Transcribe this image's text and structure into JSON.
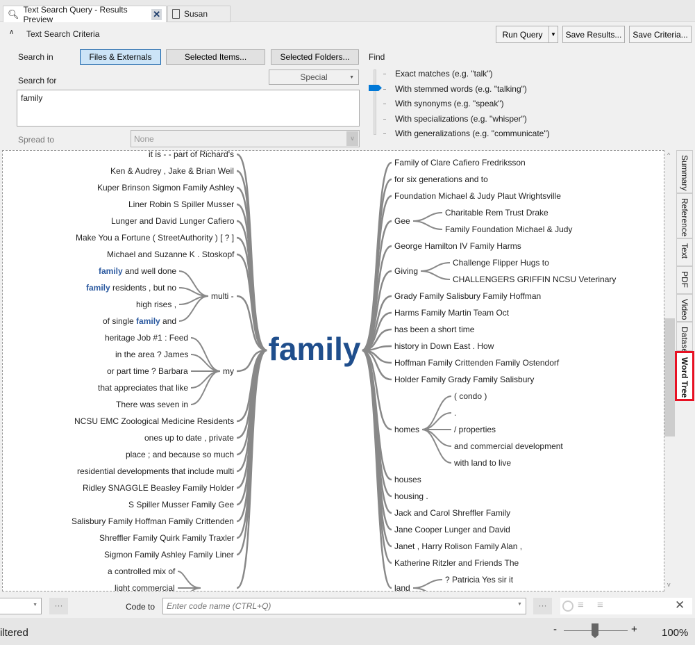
{
  "tabs": [
    {
      "label": "Text Search Query - Results Preview",
      "icon": "text-search-icon",
      "active": true
    },
    {
      "label": "Susan",
      "icon": "document-icon",
      "active": false
    }
  ],
  "criteria": {
    "title": "Text Search Criteria",
    "search_in_label": "Search in",
    "scope_buttons": [
      "Files & Externals",
      "Selected Items...",
      "Selected Folders..."
    ],
    "search_for_label": "Search for",
    "special_label": "Special",
    "search_value": "family",
    "spread_label": "Spread to",
    "spread_value": "None",
    "run_query": "Run Query",
    "save_results": "Save Results...",
    "save_criteria": "Save Criteria...",
    "find_label": "Find",
    "find_options": [
      "Exact matches (e.g. \"talk\")",
      "With stemmed words (e.g. \"talking\")",
      "With synonyms (e.g. \"speak\")",
      "With specializations (e.g. \"whisper\")",
      "With generalizations (e.g. \"communicate\")"
    ],
    "find_selected_index": 1,
    "accent": "#0078d7"
  },
  "word_tree": {
    "root": "family",
    "root_color": "#1f4e8c",
    "left": [
      {
        "text": [
          {
            "t": "it is - - part of Richard's"
          }
        ]
      },
      {
        "text": [
          {
            "t": "Ken & Audrey , Jake & Brian Weil"
          }
        ]
      },
      {
        "text": [
          {
            "t": "Kuper Brinson Sigmon Family Ashley"
          }
        ]
      },
      {
        "text": [
          {
            "t": "Liner Robin S Spiller Musser"
          }
        ]
      },
      {
        "text": [
          {
            "t": "Lunger and David Lunger Cafiero"
          }
        ]
      },
      {
        "text": [
          {
            "t": "Make You a Fortune ( StreetAuthority ) [ ? ]"
          }
        ]
      },
      {
        "text": [
          {
            "t": "Michael and Suzanne K . Stoskopf"
          }
        ]
      },
      {
        "label": "multi -",
        "children": [
          [
            {
              "t": "family",
              "hl": true
            },
            {
              "t": " and well done"
            }
          ],
          [
            {
              "t": "family",
              "hl": true
            },
            {
              "t": " residents , but no"
            }
          ],
          [
            {
              "t": "high rises ,"
            }
          ],
          [
            {
              "t": "of single "
            },
            {
              "t": "family",
              "hl": true
            },
            {
              "t": " and"
            }
          ]
        ]
      },
      {
        "label": "my",
        "children": [
          [
            {
              "t": "heritage Job #1 : Feed"
            }
          ],
          [
            {
              "t": "in the area ? James"
            }
          ],
          [
            {
              "t": "or part time ? Barbara"
            }
          ],
          [
            {
              "t": "that appreciates that like"
            }
          ],
          [
            {
              "t": "There was seven in"
            }
          ]
        ]
      },
      {
        "text": [
          {
            "t": "NCSU EMC Zoological Medicine Residents"
          }
        ]
      },
      {
        "text": [
          {
            "t": "ones up to date , private"
          }
        ]
      },
      {
        "text": [
          {
            "t": "place ; and because so much"
          }
        ]
      },
      {
        "text": [
          {
            "t": "residential developments that include multi"
          }
        ]
      },
      {
        "text": [
          {
            "t": "Ridley SNAGGLE Beasley Family Holder"
          }
        ]
      },
      {
        "text": [
          {
            "t": "S Spiller Musser Family Gee"
          }
        ]
      },
      {
        "text": [
          {
            "t": "Salisbury Family Hoffman Family Crittenden"
          }
        ]
      },
      {
        "text": [
          {
            "t": "Shreffler Family Quirk Family Traxler"
          }
        ]
      },
      {
        "text": [
          {
            "t": "Sigmon Family Ashley Family Liner"
          }
        ]
      },
      {
        "label": "",
        "children": [
          [
            {
              "t": "a controlled mix of"
            }
          ],
          [
            {
              "t": "light commercial"
            }
          ],
          [
            {
              "t": ""
            }
          ]
        ]
      }
    ],
    "right": [
      {
        "text": [
          {
            "t": "Family of Clare Cafiero Fredriksson"
          }
        ]
      },
      {
        "text": [
          {
            "t": "for six generations and to"
          }
        ]
      },
      {
        "text": [
          {
            "t": "Foundation Michael & Judy Plaut Wrightsville"
          }
        ]
      },
      {
        "label": "Gee",
        "children": [
          [
            {
              "t": "Charitable Rem Trust Drake"
            }
          ],
          [
            {
              "t": "Family Foundation Michael & Judy"
            }
          ]
        ]
      },
      {
        "text": [
          {
            "t": "George Hamilton IV Family Harms"
          }
        ]
      },
      {
        "label": "Giving",
        "children": [
          [
            {
              "t": "Challenge Flipper Hugs to"
            }
          ],
          [
            {
              "t": "CHALLENGERS GRIFFIN NCSU Veterinary"
            }
          ]
        ]
      },
      {
        "text": [
          {
            "t": "Grady Family Salisbury Family Hoffman"
          }
        ]
      },
      {
        "text": [
          {
            "t": "Harms Family Martin Team Oct"
          }
        ]
      },
      {
        "text": [
          {
            "t": "has been a short time"
          }
        ]
      },
      {
        "text": [
          {
            "t": "history in Down East . How"
          }
        ]
      },
      {
        "text": [
          {
            "t": "Hoffman Family Crittenden Family Ostendorf"
          }
        ]
      },
      {
        "text": [
          {
            "t": "Holder Family Grady Family Salisbury"
          }
        ]
      },
      {
        "label": "homes",
        "children": [
          [
            {
              "t": "( condo )"
            }
          ],
          [
            {
              "t": "."
            }
          ],
          [
            {
              "t": "/ properties"
            }
          ],
          [
            {
              "t": "and commercial development"
            }
          ],
          [
            {
              "t": "with land to live"
            }
          ]
        ]
      },
      {
        "text": [
          {
            "t": "houses"
          }
        ]
      },
      {
        "text": [
          {
            "t": "housing ."
          }
        ]
      },
      {
        "text": [
          {
            "t": "Jack and Carol Shreffler Family"
          }
        ]
      },
      {
        "text": [
          {
            "t": "Jane Cooper Lunger and David"
          }
        ]
      },
      {
        "text": [
          {
            "t": "Janet , Harry Rolison Family Alan ,"
          }
        ]
      },
      {
        "text": [
          {
            "t": "Katherine Ritzler and Friends The"
          }
        ]
      },
      {
        "label": "land",
        "children": [
          [
            {
              "t": "? Patricia Yes sir it"
            }
          ],
          [
            {
              "t": ""
            }
          ]
        ]
      }
    ]
  },
  "side_tabs": [
    {
      "label": "Summary"
    },
    {
      "label": "Reference"
    },
    {
      "label": "Text"
    },
    {
      "label": "PDF"
    },
    {
      "label": "Video"
    },
    {
      "label": "Dataset"
    },
    {
      "label": "Word Tree",
      "active": true
    }
  ],
  "highlight_color": "#e81123",
  "coding_bar": {
    "code_to_label": "Code to",
    "placeholder": "Enter code name (CTRL+Q)",
    "more": "···"
  },
  "status": {
    "text": "iltered",
    "zoom": "100%",
    "zoom_minus": "-",
    "zoom_plus": "+",
    "zoom_level_percent": 100
  }
}
